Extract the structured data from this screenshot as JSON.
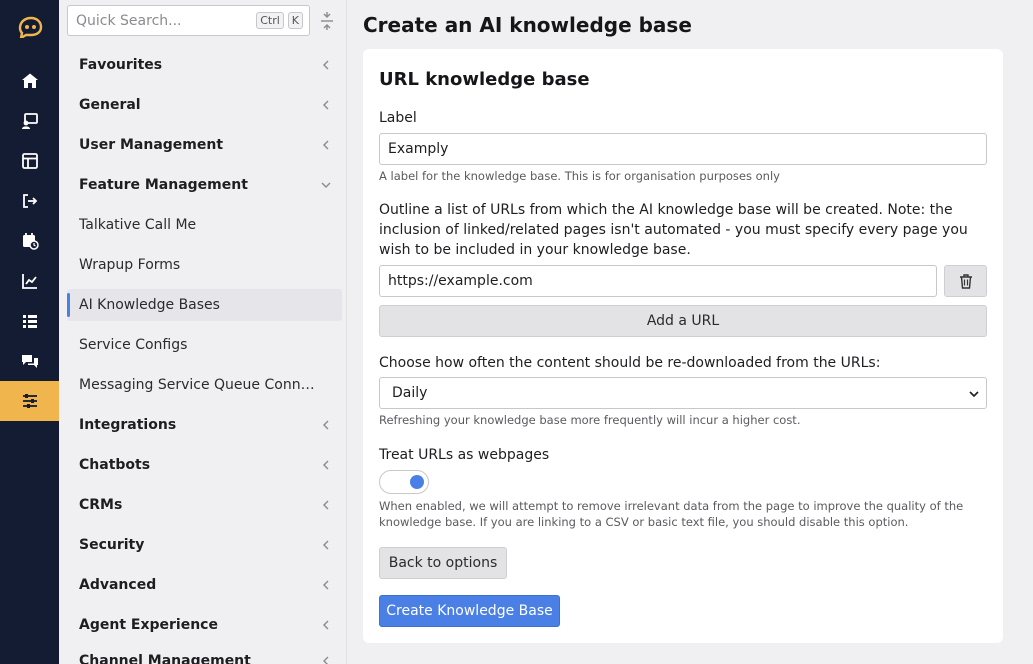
{
  "rail": {
    "items": [
      {
        "name": "logo-icon"
      },
      {
        "name": "home-icon"
      },
      {
        "name": "agent-screen-icon"
      },
      {
        "name": "layout-icon"
      },
      {
        "name": "exit-icon"
      },
      {
        "name": "calendar-clock-icon"
      },
      {
        "name": "analytics-icon"
      },
      {
        "name": "list-icon"
      },
      {
        "name": "chat-icon"
      },
      {
        "name": "settings-sliders-icon",
        "active": true
      }
    ],
    "accent": "#f0b54c",
    "background": "#141c33"
  },
  "sidebar": {
    "search": {
      "placeholder": "Quick Search...",
      "kbd1": "Ctrl",
      "kbd2": "K"
    },
    "items": [
      {
        "label": "Favourites",
        "type": "section"
      },
      {
        "label": "General",
        "type": "section"
      },
      {
        "label": "User Management",
        "type": "section"
      },
      {
        "label": "Feature Management",
        "type": "section",
        "expanded": true
      },
      {
        "label": "Talkative Call Me",
        "type": "child"
      },
      {
        "label": "Wrapup Forms",
        "type": "child"
      },
      {
        "label": "AI Knowledge Bases",
        "type": "child",
        "active": true
      },
      {
        "label": "Service Configs",
        "type": "child"
      },
      {
        "label": "Messaging Service Queue Connec...",
        "type": "child"
      },
      {
        "label": "Integrations",
        "type": "section"
      },
      {
        "label": "Chatbots",
        "type": "section"
      },
      {
        "label": "CRMs",
        "type": "section"
      },
      {
        "label": "Security",
        "type": "section"
      },
      {
        "label": "Advanced",
        "type": "section"
      },
      {
        "label": "Agent Experience",
        "type": "section"
      },
      {
        "label": "Channel Management",
        "type": "section"
      }
    ]
  },
  "main": {
    "title": "Create an AI knowledge base",
    "card": {
      "title": "URL knowledge base",
      "label_field": {
        "label": "Label",
        "value": "Examply",
        "help": "A label for the knowledge base. This is for organisation purposes only"
      },
      "urls": {
        "description": "Outline a list of URLs from which the AI knowledge base will be created. Note: the inclusion of linked/related pages isn't automated - you must specify every page you wish to be included in your knowledge base.",
        "url_value": "https://example.com",
        "add_label": "Add a URL"
      },
      "refresh": {
        "label": "Choose how often the content should be re-downloaded from the URLs:",
        "selected": "Daily",
        "help": "Refreshing your knowledge base more frequently will incur a higher cost."
      },
      "webpages": {
        "label": "Treat URLs as webpages",
        "enabled": true,
        "help": "When enabled, we will attempt to remove irrelevant data from the page to improve the quality of the knowledge base. If you are linking to a CSV or basic text file, you should disable this option."
      },
      "back_label": "Back to options",
      "create_label": "Create Knowledge Base"
    }
  },
  "colors": {
    "primary": "#4a7fe6",
    "page_bg": "#f0f0f2"
  }
}
